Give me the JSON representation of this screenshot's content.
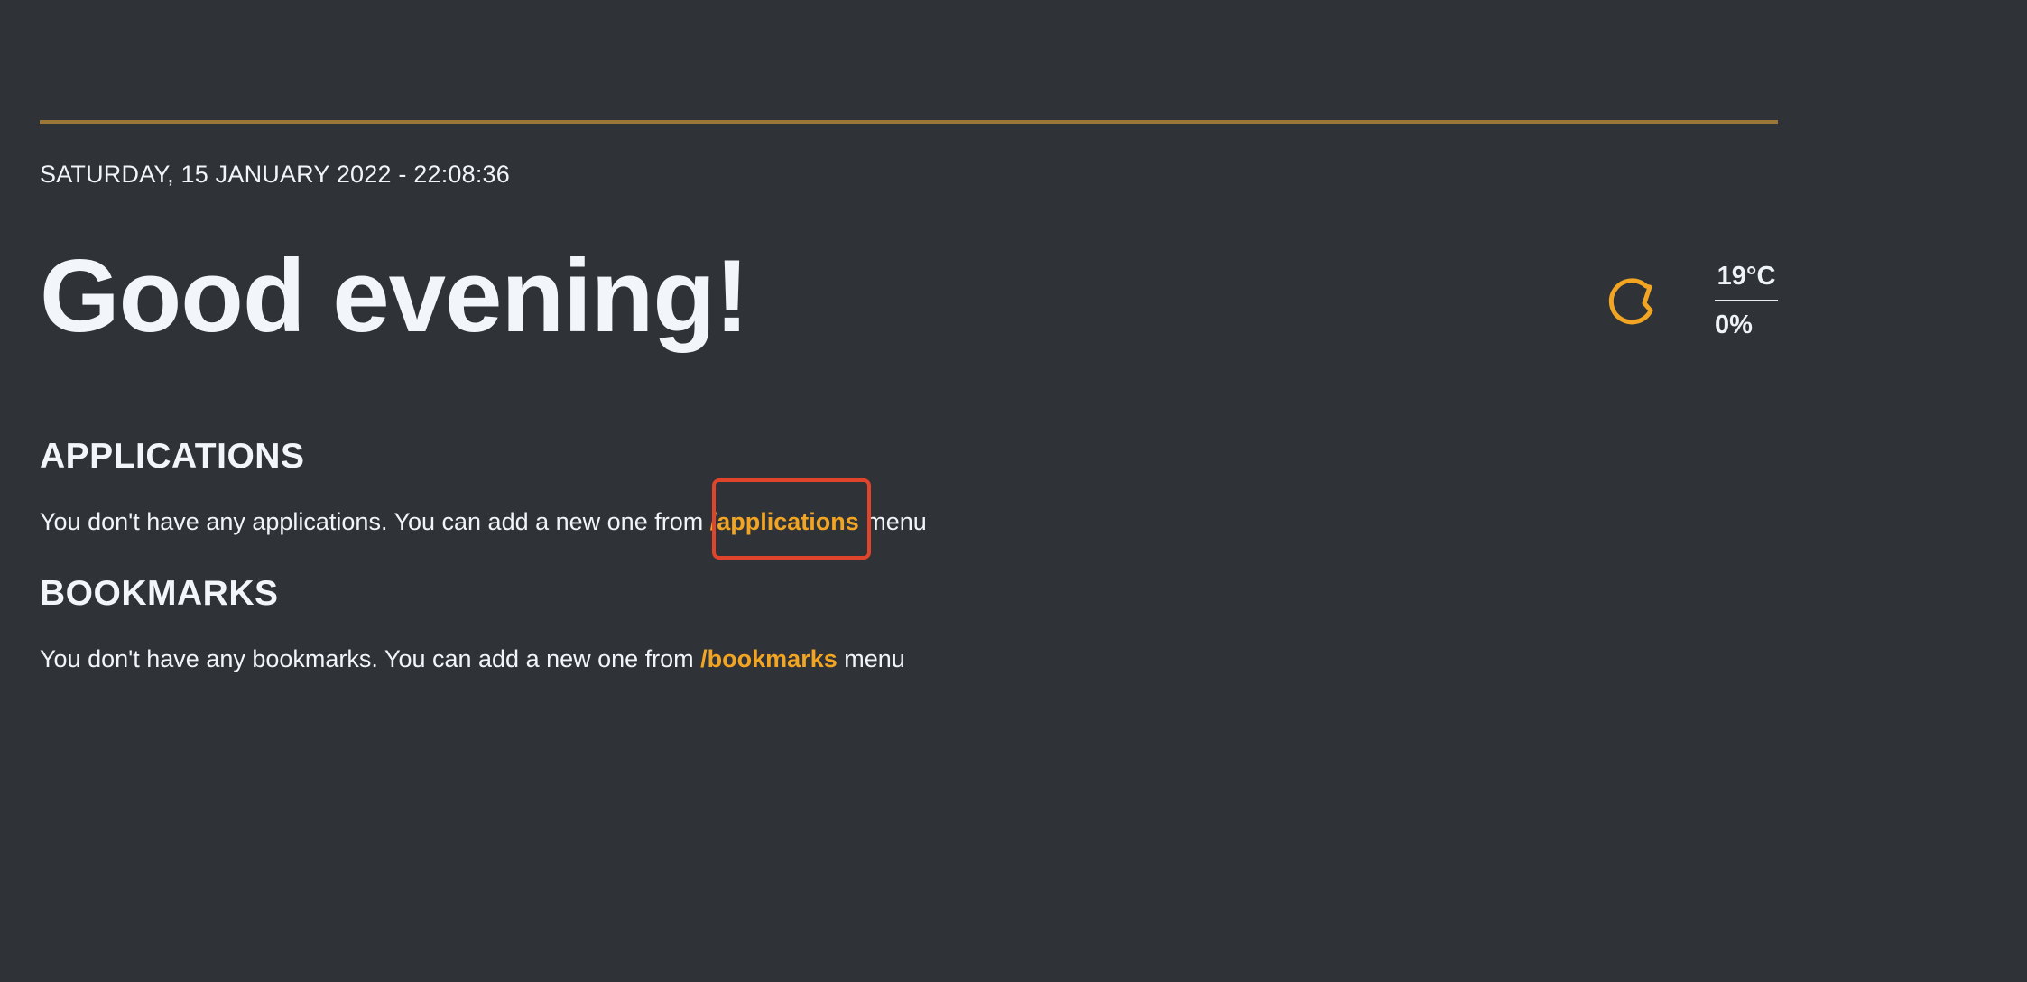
{
  "header": {
    "datetime": "SATURDAY, 15 JANUARY 2022 - 22:08:36",
    "greeting": "Good evening!"
  },
  "weather": {
    "icon": "moon-icon",
    "temperature": "19°C",
    "humidity": "0%"
  },
  "applications": {
    "title": "APPLICATIONS",
    "text_before": "You don't have any applications. You can add a new one from ",
    "link": "/applications",
    "text_after": " menu"
  },
  "bookmarks": {
    "title": "BOOKMARKS",
    "text_before": "You don't have any bookmarks. You can add a new one from ",
    "link": "/bookmarks",
    "text_after": " menu"
  },
  "colors": {
    "background": "#2f3337",
    "accent": "#f2a423",
    "rule": "#9a7638",
    "highlight": "#e0442a"
  }
}
